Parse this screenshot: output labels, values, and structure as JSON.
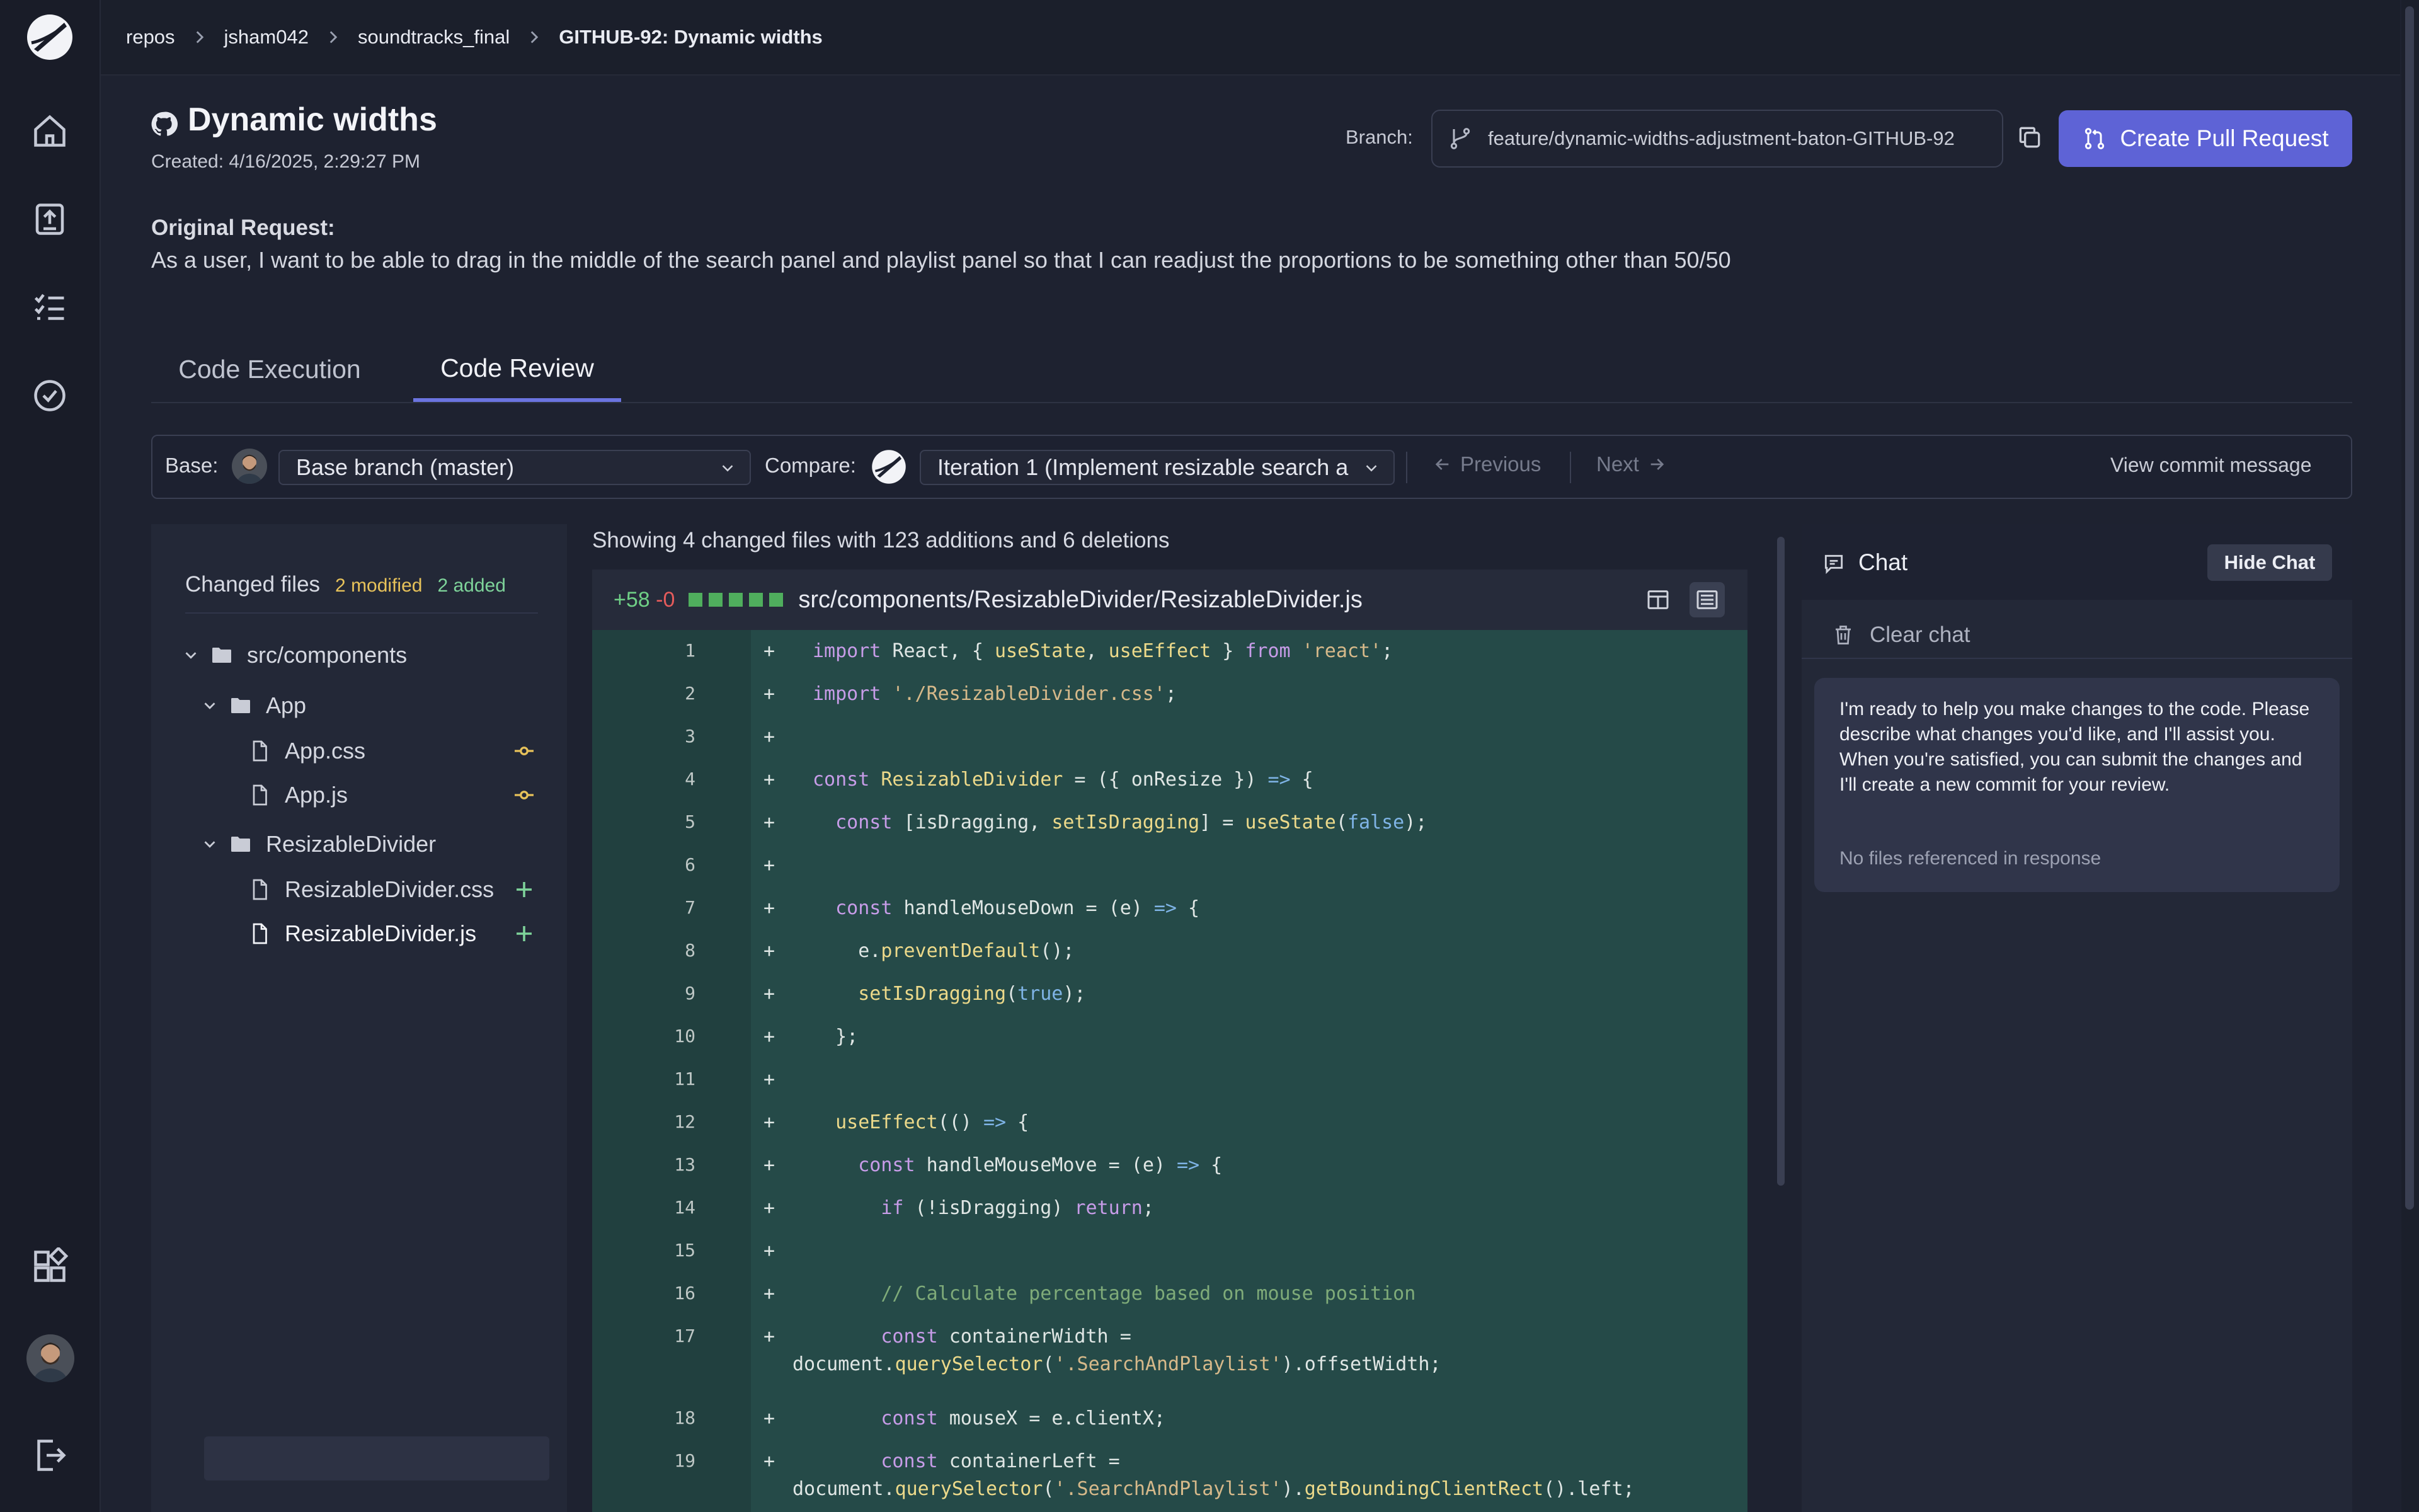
{
  "breadcrumbs": [
    "repos",
    "jsham042",
    "soundtracks_final",
    "GITHUB-92: Dynamic widths"
  ],
  "header": {
    "title": "Dynamic widths",
    "created": "Created: 4/16/2025, 2:29:27 PM",
    "branch_label": "Branch:",
    "branch_value": "feature/dynamic-widths-adjustment-baton-GITHUB-92",
    "create_pr_label": "Create Pull Request",
    "request_label": "Original Request:",
    "request_text": "As a user, I want to be able to drag in the middle of the search panel and playlist panel so that I can readjust the proportions to be something other than 50/50"
  },
  "tabs": [
    {
      "label": "Code Execution",
      "active": false
    },
    {
      "label": "Code Review",
      "active": true
    }
  ],
  "compare_bar": {
    "base_label": "Base:",
    "base_value": "Base branch (master)",
    "compare_label": "Compare:",
    "compare_value": "Iteration 1 (Implement resizable search a",
    "previous_label": "Previous",
    "next_label": "Next",
    "view_commit_label": "View commit message"
  },
  "files_panel": {
    "title": "Changed files",
    "modified": "2 modified",
    "added": "2 added",
    "tree": [
      {
        "name": "src/components",
        "type": "folder"
      },
      {
        "name": "App",
        "type": "folder"
      },
      {
        "name": "App.css",
        "type": "file",
        "status": "modified"
      },
      {
        "name": "App.js",
        "type": "file",
        "status": "modified"
      },
      {
        "name": "ResizableDivider",
        "type": "folder"
      },
      {
        "name": "ResizableDivider.css",
        "type": "file",
        "status": "added"
      },
      {
        "name": "ResizableDivider.js",
        "type": "file",
        "status": "added",
        "selected": true
      }
    ]
  },
  "diff": {
    "summary": "Showing 4 changed files with 123 additions and 6 deletions",
    "additions": "+58",
    "deletions": "-0",
    "file_path": "src/components/ResizableDivider/ResizableDivider.js",
    "lines": [
      {
        "n": "1",
        "t": "import React, { useState, useEffect } from 'react';"
      },
      {
        "n": "2",
        "t": "import './ResizableDivider.css';"
      },
      {
        "n": "3",
        "t": ""
      },
      {
        "n": "4",
        "t": "const ResizableDivider = ({ onResize }) => {"
      },
      {
        "n": "5",
        "t": "  const [isDragging, setIsDragging] = useState(false);"
      },
      {
        "n": "6",
        "t": ""
      },
      {
        "n": "7",
        "t": "  const handleMouseDown = (e) => {"
      },
      {
        "n": "8",
        "t": "    e.preventDefault();"
      },
      {
        "n": "9",
        "t": "    setIsDragging(true);"
      },
      {
        "n": "10",
        "t": "  };"
      },
      {
        "n": "11",
        "t": ""
      },
      {
        "n": "12",
        "t": "  useEffect(() => {"
      },
      {
        "n": "13",
        "t": "    const handleMouseMove = (e) => {"
      },
      {
        "n": "14",
        "t": "      if (!isDragging) return;"
      },
      {
        "n": "15",
        "t": ""
      },
      {
        "n": "16",
        "t": "      // Calculate percentage based on mouse position"
      },
      {
        "n": "17",
        "t": "      const containerWidth =",
        "wrap": "document.querySelector('.SearchAndPlaylist').offsetWidth;"
      },
      {
        "n": "18",
        "t": "      const mouseX = e.clientX;"
      },
      {
        "n": "19",
        "t": "      const containerLeft =",
        "wrap": "document.querySelector('.SearchAndPlaylist').getBoundingClientRect().left;"
      }
    ]
  },
  "chat": {
    "title": "Chat",
    "hide_label": "Hide Chat",
    "clear_label": "Clear chat",
    "message": "I'm ready to help you make changes to the code. Please describe what changes you'd like, and I'll assist you. When you're satisfied, you can submit the changes and I'll create a new commit for your review.",
    "no_files": "No files referenced in response"
  },
  "colors": {
    "accent": "#5e63d6",
    "modified": "#e7c25a",
    "added": "#7ed39a",
    "deletion": "#e55b5b",
    "diff_added_bg": "#254a48"
  },
  "icons": [
    "logo-icon",
    "home-icon",
    "upload-icon",
    "checklist-icon",
    "check-circle-icon",
    "widgets-icon",
    "logout-icon",
    "github-icon",
    "branch-icon",
    "copy-icon",
    "pull-request-icon",
    "folder-icon",
    "file-icon",
    "chat-icon",
    "trash-icon"
  ]
}
